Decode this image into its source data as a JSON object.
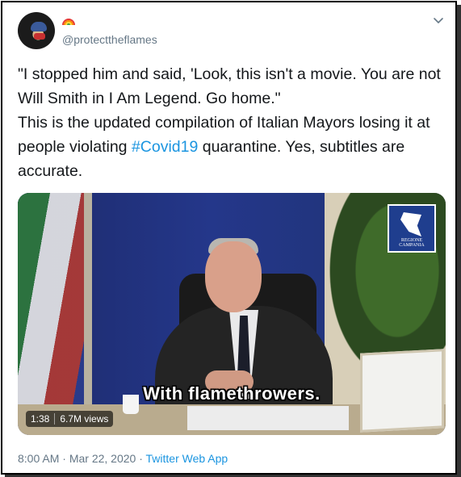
{
  "tweet": {
    "handle": "@protecttheflames",
    "name_emoji": "rainbow",
    "avatar_icon": "avatar-portrait-icon",
    "menu_icon": "chevron-down-icon",
    "text_line1": "\"I stopped him and said, 'Look, this isn't a movie. You are not Will Smith in I Am Legend. Go home.\"",
    "text_line2_before": "This is the updated compilation of Italian Mayors losing it at people violating ",
    "hashtag": "#Covid19",
    "text_line2_after": " quarantine. Yes, subtitles are accurate.",
    "media": {
      "subtitle": "With flamethrowers.",
      "duration": "1:38",
      "views": "6.7M views",
      "logo_text": "REGIONE CAMPANIA"
    },
    "time": "8:00 AM",
    "date": "Mar 22, 2020",
    "separator": "·",
    "source": "Twitter Web App"
  },
  "colors": {
    "text": "#14171a",
    "secondary": "#657786",
    "link": "#1b95e0"
  }
}
